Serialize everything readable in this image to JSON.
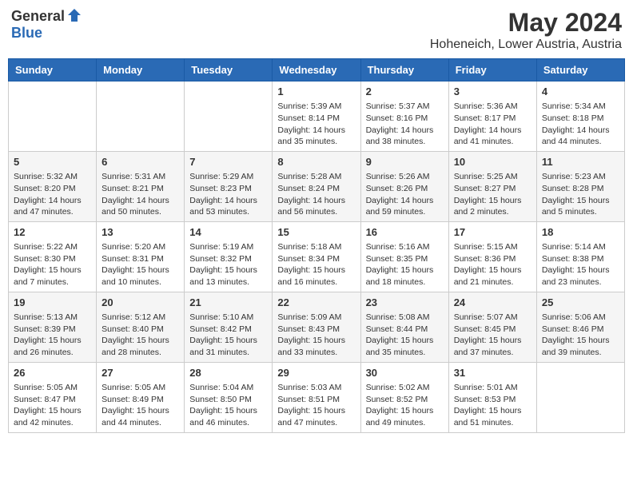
{
  "header": {
    "logo_general": "General",
    "logo_blue": "Blue",
    "month_title": "May 2024",
    "subtitle": "Hoheneich, Lower Austria, Austria"
  },
  "calendar": {
    "days_of_week": [
      "Sunday",
      "Monday",
      "Tuesday",
      "Wednesday",
      "Thursday",
      "Friday",
      "Saturday"
    ],
    "weeks": [
      [
        {
          "day": "",
          "info": ""
        },
        {
          "day": "",
          "info": ""
        },
        {
          "day": "",
          "info": ""
        },
        {
          "day": "1",
          "info": "Sunrise: 5:39 AM\nSunset: 8:14 PM\nDaylight: 14 hours\nand 35 minutes."
        },
        {
          "day": "2",
          "info": "Sunrise: 5:37 AM\nSunset: 8:16 PM\nDaylight: 14 hours\nand 38 minutes."
        },
        {
          "day": "3",
          "info": "Sunrise: 5:36 AM\nSunset: 8:17 PM\nDaylight: 14 hours\nand 41 minutes."
        },
        {
          "day": "4",
          "info": "Sunrise: 5:34 AM\nSunset: 8:18 PM\nDaylight: 14 hours\nand 44 minutes."
        }
      ],
      [
        {
          "day": "5",
          "info": "Sunrise: 5:32 AM\nSunset: 8:20 PM\nDaylight: 14 hours\nand 47 minutes."
        },
        {
          "day": "6",
          "info": "Sunrise: 5:31 AM\nSunset: 8:21 PM\nDaylight: 14 hours\nand 50 minutes."
        },
        {
          "day": "7",
          "info": "Sunrise: 5:29 AM\nSunset: 8:23 PM\nDaylight: 14 hours\nand 53 minutes."
        },
        {
          "day": "8",
          "info": "Sunrise: 5:28 AM\nSunset: 8:24 PM\nDaylight: 14 hours\nand 56 minutes."
        },
        {
          "day": "9",
          "info": "Sunrise: 5:26 AM\nSunset: 8:26 PM\nDaylight: 14 hours\nand 59 minutes."
        },
        {
          "day": "10",
          "info": "Sunrise: 5:25 AM\nSunset: 8:27 PM\nDaylight: 15 hours\nand 2 minutes."
        },
        {
          "day": "11",
          "info": "Sunrise: 5:23 AM\nSunset: 8:28 PM\nDaylight: 15 hours\nand 5 minutes."
        }
      ],
      [
        {
          "day": "12",
          "info": "Sunrise: 5:22 AM\nSunset: 8:30 PM\nDaylight: 15 hours\nand 7 minutes."
        },
        {
          "day": "13",
          "info": "Sunrise: 5:20 AM\nSunset: 8:31 PM\nDaylight: 15 hours\nand 10 minutes."
        },
        {
          "day": "14",
          "info": "Sunrise: 5:19 AM\nSunset: 8:32 PM\nDaylight: 15 hours\nand 13 minutes."
        },
        {
          "day": "15",
          "info": "Sunrise: 5:18 AM\nSunset: 8:34 PM\nDaylight: 15 hours\nand 16 minutes."
        },
        {
          "day": "16",
          "info": "Sunrise: 5:16 AM\nSunset: 8:35 PM\nDaylight: 15 hours\nand 18 minutes."
        },
        {
          "day": "17",
          "info": "Sunrise: 5:15 AM\nSunset: 8:36 PM\nDaylight: 15 hours\nand 21 minutes."
        },
        {
          "day": "18",
          "info": "Sunrise: 5:14 AM\nSunset: 8:38 PM\nDaylight: 15 hours\nand 23 minutes."
        }
      ],
      [
        {
          "day": "19",
          "info": "Sunrise: 5:13 AM\nSunset: 8:39 PM\nDaylight: 15 hours\nand 26 minutes."
        },
        {
          "day": "20",
          "info": "Sunrise: 5:12 AM\nSunset: 8:40 PM\nDaylight: 15 hours\nand 28 minutes."
        },
        {
          "day": "21",
          "info": "Sunrise: 5:10 AM\nSunset: 8:42 PM\nDaylight: 15 hours\nand 31 minutes."
        },
        {
          "day": "22",
          "info": "Sunrise: 5:09 AM\nSunset: 8:43 PM\nDaylight: 15 hours\nand 33 minutes."
        },
        {
          "day": "23",
          "info": "Sunrise: 5:08 AM\nSunset: 8:44 PM\nDaylight: 15 hours\nand 35 minutes."
        },
        {
          "day": "24",
          "info": "Sunrise: 5:07 AM\nSunset: 8:45 PM\nDaylight: 15 hours\nand 37 minutes."
        },
        {
          "day": "25",
          "info": "Sunrise: 5:06 AM\nSunset: 8:46 PM\nDaylight: 15 hours\nand 39 minutes."
        }
      ],
      [
        {
          "day": "26",
          "info": "Sunrise: 5:05 AM\nSunset: 8:47 PM\nDaylight: 15 hours\nand 42 minutes."
        },
        {
          "day": "27",
          "info": "Sunrise: 5:05 AM\nSunset: 8:49 PM\nDaylight: 15 hours\nand 44 minutes."
        },
        {
          "day": "28",
          "info": "Sunrise: 5:04 AM\nSunset: 8:50 PM\nDaylight: 15 hours\nand 46 minutes."
        },
        {
          "day": "29",
          "info": "Sunrise: 5:03 AM\nSunset: 8:51 PM\nDaylight: 15 hours\nand 47 minutes."
        },
        {
          "day": "30",
          "info": "Sunrise: 5:02 AM\nSunset: 8:52 PM\nDaylight: 15 hours\nand 49 minutes."
        },
        {
          "day": "31",
          "info": "Sunrise: 5:01 AM\nSunset: 8:53 PM\nDaylight: 15 hours\nand 51 minutes."
        },
        {
          "day": "",
          "info": ""
        }
      ]
    ]
  }
}
